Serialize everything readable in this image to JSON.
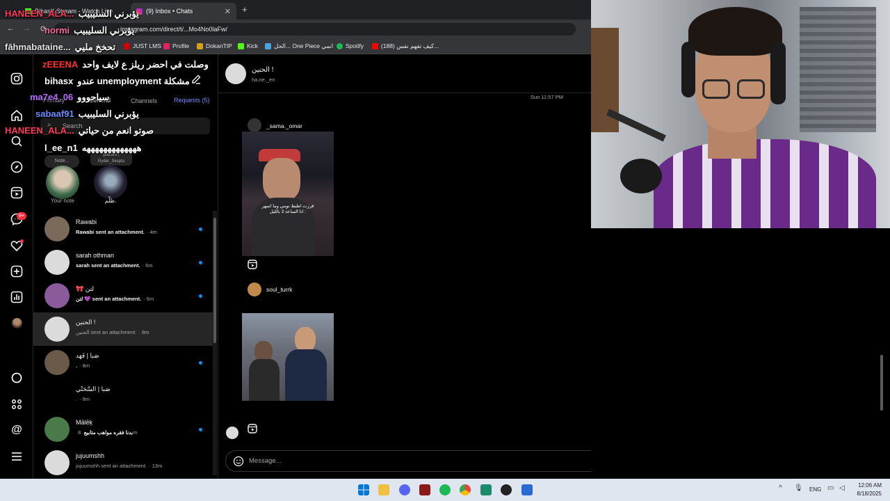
{
  "browser": {
    "tabs": [
      {
        "title": "BihasX Stream - Watch Live",
        "active": false
      },
      {
        "title": "(9) Inbox • Chats",
        "active": true
      }
    ],
    "address": "instagram.com/direct/t/...Mo4No0laFw/",
    "bookmarks": [
      "JUST LMS",
      "Profile",
      "DokanTIP",
      "Kick",
      "الحل... One Piece انمي",
      "Spotify",
      "(188) كيف تفهم نفس..."
    ]
  },
  "rail": {
    "icons": [
      "instagram-icon",
      "home-icon",
      "search-icon",
      "explore-icon",
      "reels-icon",
      "messages-icon",
      "notifications-icon",
      "create-icon",
      "dashboard-icon",
      "profile-icon",
      "threads-circle-icon",
      "apps-icon",
      "threads-icon",
      "menu-icon"
    ],
    "messages_badge": "9+"
  },
  "inbox": {
    "tabs": [
      "Primary",
      "General",
      "Channels",
      "Requests (5)"
    ],
    "search_placeholder": "Search",
    "notes": [
      {
        "label": "Your note",
        "bubble": "Note..."
      },
      {
        "label": "ظلّم.",
        "bubble": "ptacore | Ryder_Skepta"
      }
    ],
    "threads": [
      {
        "name": "Rawabi",
        "preview_bold": "Rawabi sent an attachment.",
        "time": "· 4m",
        "unread": true,
        "avatar": "#7a6a5a"
      },
      {
        "name": "sarah othman",
        "preview_bold": "sarah sent an attachment.",
        "time": "· 6m",
        "unread": true,
        "avatar": "#dbdbdb"
      },
      {
        "name": "🎀 لتن",
        "preview_bold": "لتن 💜 sent an attachment.",
        "time": "· 6m",
        "unread": true,
        "avatar": "#8a5a9a"
      },
      {
        "name": "الحنين !",
        "preview": "الحنين sent an attachment.",
        "time": "· 8m",
        "unread": false,
        "selected": true,
        "avatar": "#dbdbdb"
      },
      {
        "name": "صَبا | فَهَد",
        "preview_bold": ".",
        "time": "· 8m",
        "unread": true,
        "avatar": "#6a5a4a"
      },
      {
        "name": "صَبا | السَّحَتّي",
        "preview": ".",
        "time": "· 8m",
        "unread": false,
        "avatar": "#000000"
      },
      {
        "name": "Mālēķ",
        "preview_bold": "بدنا فقره مواهب متابيع",
        "time": "· 8m",
        "unread": true,
        "avatar": "#4a7a4a"
      },
      {
        "name": "jujuumshh",
        "preview": "jujuumshh sent an attachment.",
        "time": "· 13m",
        "unread": false,
        "avatar": "#dbdbdb"
      }
    ]
  },
  "chat": {
    "header_name": "الحنين !",
    "header_username": "ha.ne._en",
    "timestamp": "Sun 11:57 PM",
    "posts": [
      {
        "author": "_sama._omar",
        "caption": "قررت اظبط نومي وما اسهر\nانا الساعة 3 بالليل :"
      },
      {
        "author": "soul_turrk",
        "caption": ""
      }
    ],
    "composer_placeholder": "Message..."
  },
  "stream_chat": [
    {
      "user": "HANEEN_ALA...",
      "color": "#ff3b5c",
      "msg": "يؤبرني السليبيب"
    },
    {
      "user": "normi",
      "color": "#ff6b9a",
      "msg": "يؤبرني السليبيب"
    },
    {
      "user": "fāhmabataine...",
      "color": "#e8e8e8",
      "msg": "تحخخ مليي"
    },
    {
      "user": "zEEENA",
      "color": "#ff3030",
      "msg": "وصلت في احضر ريلز ع لايف واحد"
    },
    {
      "user": "bihasx",
      "color": "#ffffff",
      "msg": "عندو unemployment مشكلة"
    },
    {
      "user": "ma7e4_06",
      "color": "#b86bff",
      "msg": "سياحووو"
    },
    {
      "user": "sabaaf91",
      "color": "#6b8cff",
      "msg": "يؤبرني السليبيب"
    },
    {
      "user": "HANEEN_ALA...",
      "color": "#ff3b5c",
      "msg": "صوتو انعم من حياتي"
    },
    {
      "user": "l_ee_n1",
      "color": "#ffffff",
      "msg": "هههههههههههههه"
    }
  ],
  "taskbar": {
    "lang": "ENG",
    "time": "12:06 AM",
    "date": "8/18/2025"
  }
}
